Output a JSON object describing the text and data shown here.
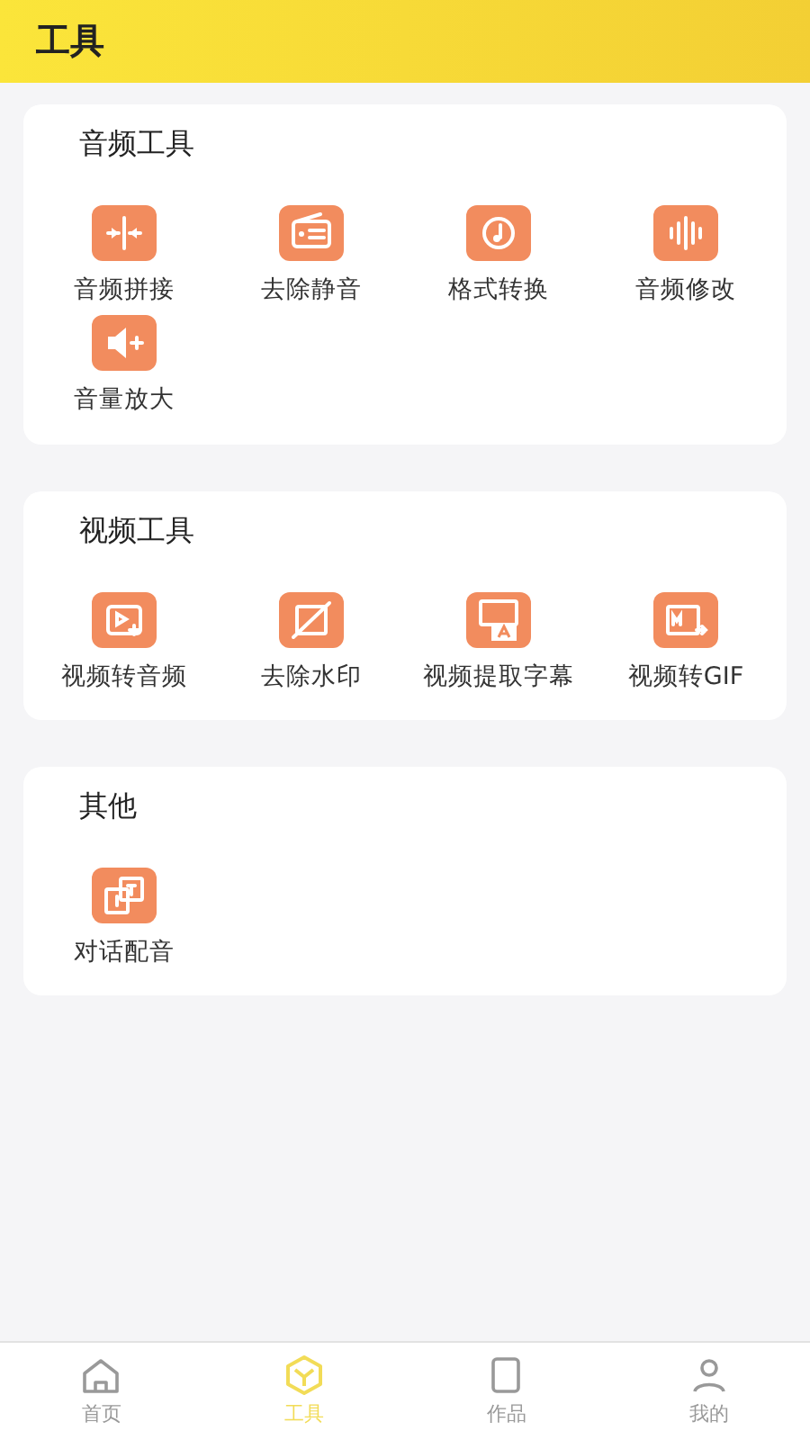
{
  "header": {
    "title": "工具"
  },
  "sections": [
    {
      "title": "音频工具",
      "tools": [
        {
          "label": "音频拼接"
        },
        {
          "label": "去除静音"
        },
        {
          "label": "格式转换"
        },
        {
          "label": "音频修改"
        },
        {
          "label": "音量放大"
        }
      ]
    },
    {
      "title": "视频工具",
      "tools": [
        {
          "label": "视频转音频"
        },
        {
          "label": "去除水印"
        },
        {
          "label": "视频提取字幕"
        },
        {
          "label": "视频转GIF"
        }
      ]
    },
    {
      "title": "其他",
      "tools": [
        {
          "label": "对话配音"
        }
      ]
    }
  ],
  "tabbar": [
    {
      "label": "首页",
      "selected": false
    },
    {
      "label": "工具",
      "selected": true
    },
    {
      "label": "作品",
      "selected": false
    },
    {
      "label": "我的",
      "selected": false
    }
  ]
}
